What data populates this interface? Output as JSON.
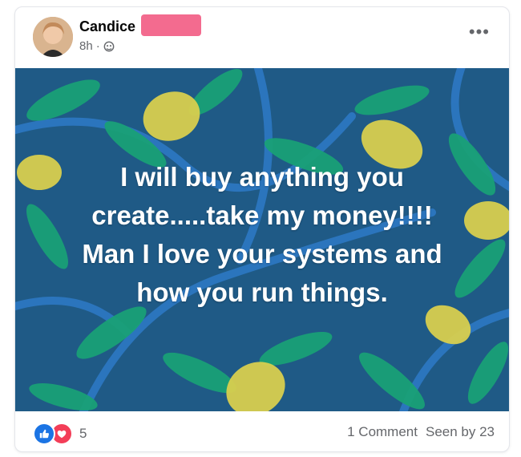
{
  "post": {
    "author_name": "Candice",
    "time": "8h",
    "separator": "·",
    "audience_icon": "friends-icon",
    "more_icon": "more-options-icon",
    "more_label": "•••",
    "text_lines": [
      "I will buy anything you",
      "create.....take my money!!!!",
      "Man I love your systems and",
      "how you run things."
    ],
    "background": {
      "base_color": "#1f5a86",
      "leaf_green": "#1aa176",
      "leaf_yellow": "#d8cf4e",
      "branch_blue": "#2d78c4"
    }
  },
  "footer": {
    "reaction_icons": [
      "like-icon",
      "love-icon"
    ],
    "reaction_count": "5",
    "comments": "1 Comment",
    "seen_by": "Seen by 23"
  },
  "colors": {
    "redaction": "#f36b8f",
    "like": "#1b74e4",
    "love": "#f33e58",
    "secondary_text": "#65676b"
  }
}
